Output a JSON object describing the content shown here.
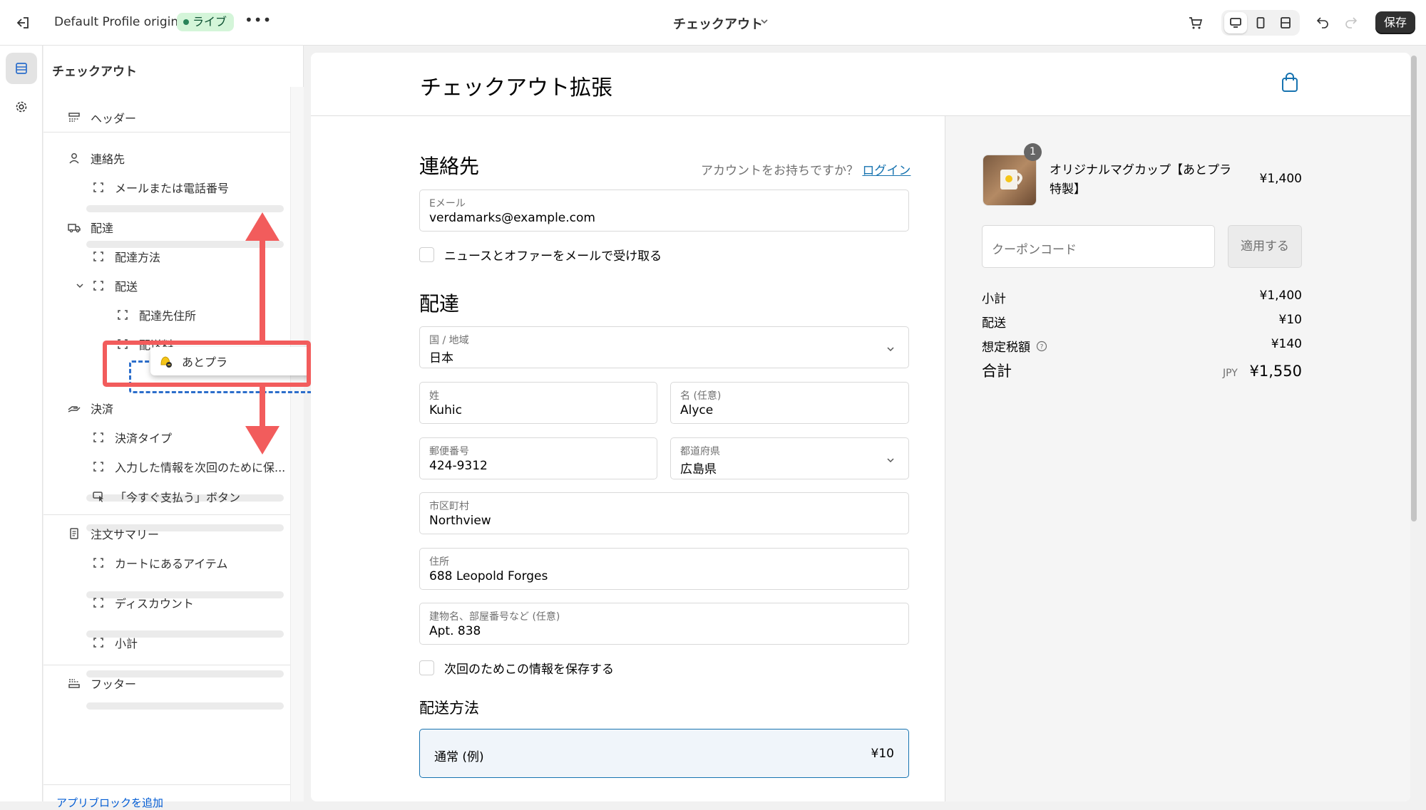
{
  "topbar": {
    "profile_name": "Default Profile original",
    "status_badge": "ライブ",
    "more_label": "•••",
    "page_selector": "チェックアウト",
    "save_label": "保存"
  },
  "sidebar": {
    "title": "チェックアウト",
    "items": {
      "header": "ヘッダー",
      "contact": "連絡先",
      "contact_field": "メールまたは電話番号",
      "delivery": "配達",
      "delivery_method": "配達方法",
      "shipping": "配送",
      "shipping_address": "配達先住所",
      "shipping_fee": "配送料",
      "dragged_app": "あとプラ",
      "payment": "決済",
      "payment_type": "決済タイプ",
      "remember_me": "入力した情報を次回のために保...",
      "pay_now_button": "「今すぐ支払う」ボタン",
      "order_summary": "注文サマリー",
      "cart_items": "カートにあるアイテム",
      "discount": "ディスカウント",
      "subtotal": "小計",
      "footer": "フッター"
    },
    "footer_link": "アプリブロックを追加"
  },
  "preview": {
    "store_title": "チェックアウト拡張",
    "contact": {
      "heading": "連絡先",
      "account_prompt": "アカウントをお持ちですか？",
      "login_link": "ログイン",
      "email_label": "Eメール",
      "email_value": "verdamarks@example.com",
      "newsletter_label": "ニュースとオファーをメールで受け取る"
    },
    "delivery": {
      "heading": "配達",
      "country_label": "国 / 地域",
      "country_value": "日本",
      "last_name_label": "姓",
      "last_name_value": "Kuhic",
      "first_name_label": "名 (任意)",
      "first_name_value": "Alyce",
      "postal_label": "郵便番号",
      "postal_value": "424-9312",
      "prefecture_label": "都道府県",
      "prefecture_value": "広島県",
      "city_label": "市区町村",
      "city_value": "Northview",
      "address_label": "住所",
      "address_value": "688 Leopold Forges",
      "address2_label": "建物名、部屋番号など (任意)",
      "address2_value": "Apt. 838",
      "save_info_label": "次回のためこの情報を保存する"
    },
    "shipping_method": {
      "heading": "配送方法",
      "option_name": "通常 (例)",
      "option_price": "¥10"
    },
    "summary": {
      "product_qty": "1",
      "product_name": "オリジナルマグカップ【あとプラ特製】",
      "product_price": "¥1,400",
      "coupon_placeholder": "クーポンコード",
      "apply_label": "適用する",
      "subtotal_label": "小計",
      "subtotal_value": "¥1,400",
      "shipping_label": "配送",
      "shipping_value": "¥10",
      "tax_label": "想定税額",
      "tax_value": "¥140",
      "total_label": "合計",
      "total_currency": "JPY",
      "total_value": "¥1,550"
    }
  },
  "colors": {
    "accent": "#1773b0",
    "annotation": "#f25c5c",
    "drop_target": "#2c6ecb",
    "live_badge": "#d4f5d9"
  }
}
